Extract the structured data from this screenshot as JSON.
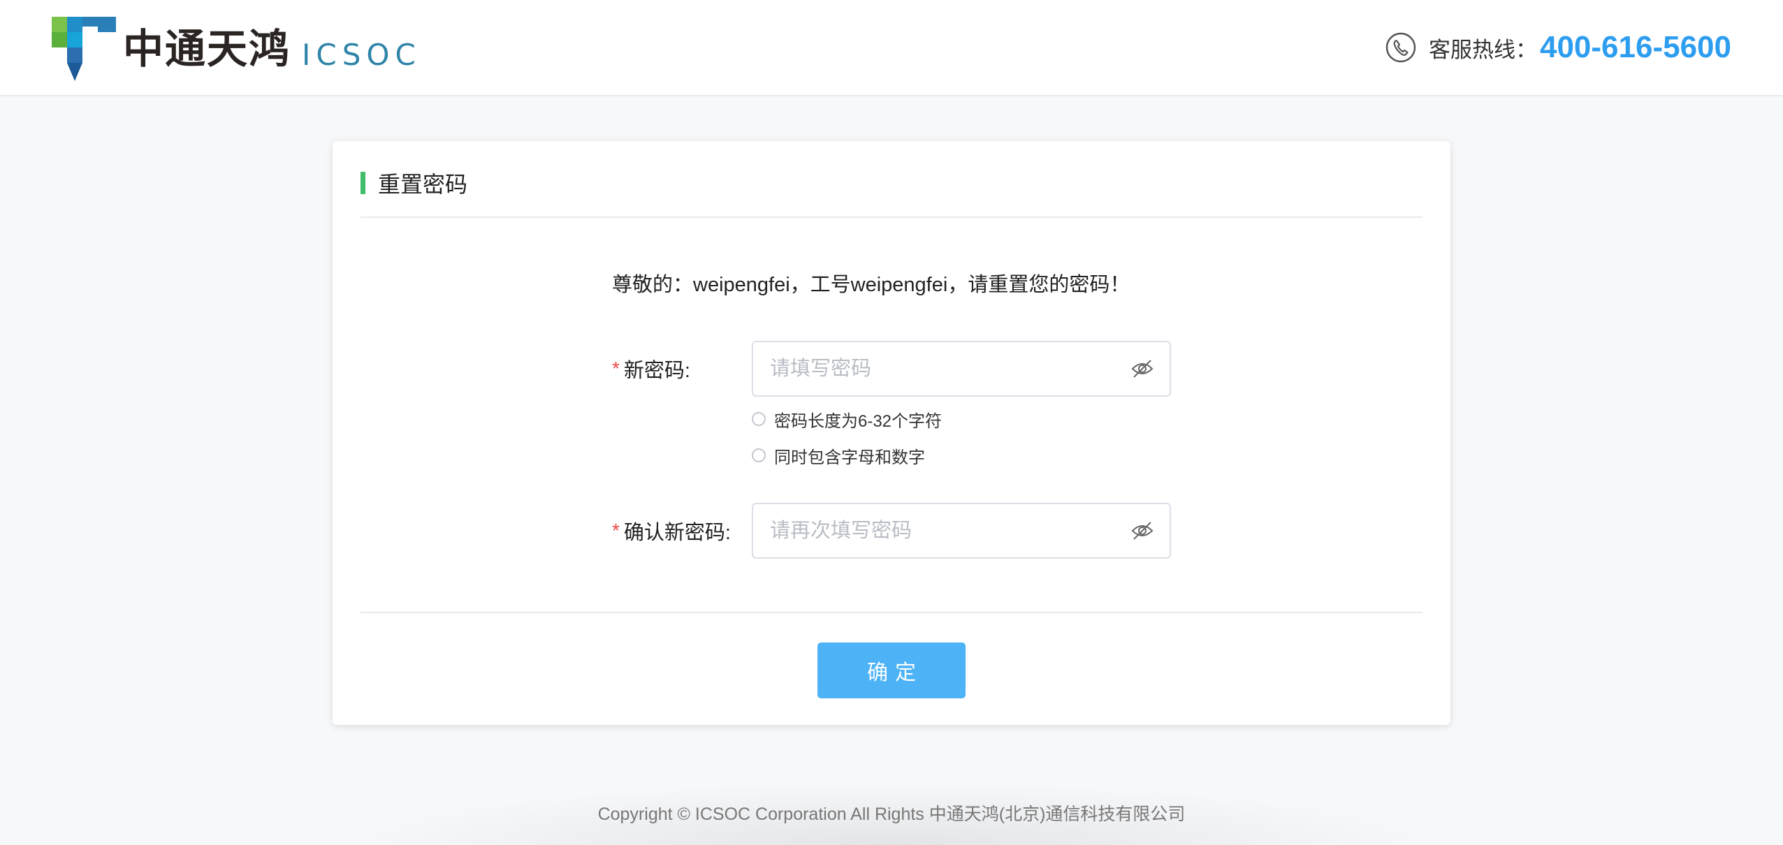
{
  "header": {
    "logo_cn": "中通天鸿",
    "logo_en": "ICSOC",
    "hotline_label": "客服热线：",
    "hotline_number": "400-616-5600",
    "icons": {
      "logo": "icsoc-logo-mark",
      "phone": "phone-icon"
    }
  },
  "card": {
    "title": "重置密码",
    "greeting": "尊敬的：weipengfei，工号weipengfei，请重置您的密码！",
    "new_password": {
      "required_mark": "*",
      "label": "新密码:",
      "placeholder": "请填写密码",
      "value": "",
      "icon": "eye-hidden-icon"
    },
    "rules": [
      {
        "text": "密码长度为6-32个字符"
      },
      {
        "text": "同时包含字母和数字"
      }
    ],
    "confirm_password": {
      "required_mark": "*",
      "label": "确认新密码:",
      "placeholder": "请再次填写密码",
      "value": "",
      "icon": "eye-hidden-icon"
    },
    "submit_label": "确定"
  },
  "footer": {
    "copyright": "Copyright © ICSOC Corporation All Rights 中通天鸿(北京)通信科技有限公司"
  },
  "colors": {
    "accent": "#4db3f6",
    "hotline": "#2d9df0",
    "title_bar": "#3fbf6a",
    "required": "#f04848"
  }
}
